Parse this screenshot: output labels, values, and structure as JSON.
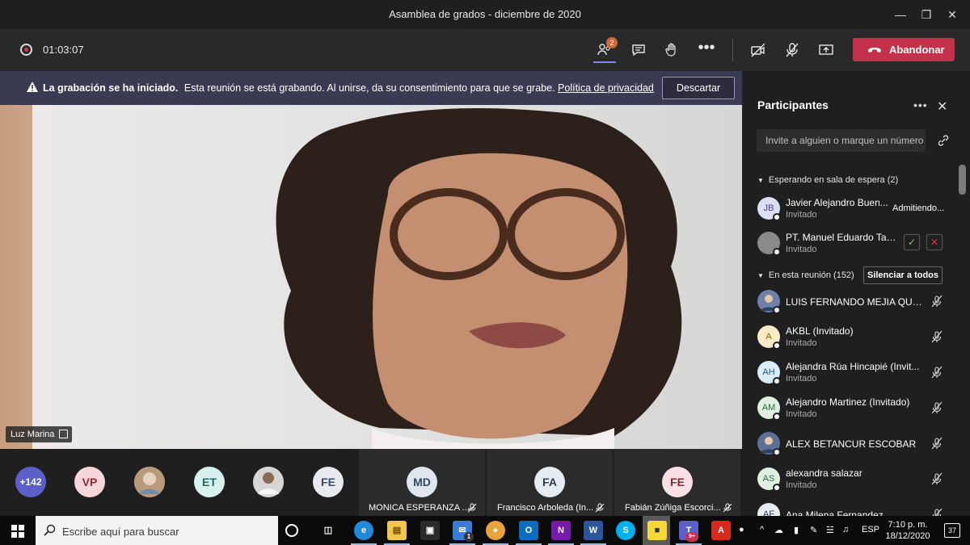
{
  "window": {
    "title": "Asamblea de grados - diciembre de 2020"
  },
  "toolbar": {
    "timer": "01:03:07",
    "participants_badge": "2",
    "leave_label": "Abandonar"
  },
  "banner": {
    "heading": "La grabación se ha iniciado.",
    "message": "Esta reunión se está grabando. Al unirse, da su consentimiento para que se grabe.",
    "link": "Política de privacidad",
    "dismiss_label": "Descartar"
  },
  "stage": {
    "speaker_name": "Luz Marina"
  },
  "strip": {
    "overflow_count": "+142",
    "avatars": [
      {
        "initials": "VP",
        "bg": "#f6d6d8",
        "fg": "#8b2b35"
      },
      {
        "initials": "",
        "bg": "#b99a7c",
        "fg": "#fff",
        "photo": true
      },
      {
        "initials": "ET",
        "bg": "#d8f0ee",
        "fg": "#1d6b66"
      },
      {
        "initials": "",
        "bg": "#c9c9c9",
        "fg": "#fff",
        "photo": true
      },
      {
        "initials": "FE",
        "bg": "#e8eaf0",
        "fg": "#3d4863"
      }
    ],
    "tiles": [
      {
        "initials": "MD",
        "name": "MONICA ESPERANZA ...",
        "bg": "#dfe6ee",
        "fg": "#2f4a66"
      },
      {
        "initials": "FA",
        "name": "Francisco Arboleda (In...",
        "bg": "#e6edf2",
        "fg": "#2d3d4b"
      },
      {
        "initials": "FE",
        "name": "Fabián Zúñiga Escorci...",
        "bg": "#fbe0e6",
        "fg": "#8a2336"
      }
    ]
  },
  "panel": {
    "title": "Participantes",
    "invite_placeholder": "Invite a alguien o marque un número",
    "lobby_label": "Esperando en sala de espera (2)",
    "in_meeting_label": "En esta reunión (152)",
    "mute_all_label": "Silenciar a todos",
    "admitting_label": "Admitiendo...",
    "lobby": [
      {
        "initials": "JB",
        "name": "Javier Alejandro Buen...",
        "sub": "Invitado",
        "bg": "#dcdff3",
        "fg": "#3b4199"
      },
      {
        "initials": "",
        "name": "PT. Manuel Eduardo Tab...",
        "sub": "Invitado",
        "bg": "#8a8a8a",
        "fg": "#fff"
      }
    ],
    "members": [
      {
        "initials": "",
        "name": "LUIS FERNANDO MEJIA QUIR...",
        "sub": "",
        "bg": "#6f7fa8",
        "fg": "#fff",
        "photo": true
      },
      {
        "initials": "A",
        "name": "AKBL (Invitado)",
        "sub": "Invitado",
        "bg": "#fbecc8",
        "fg": "#8a5a00"
      },
      {
        "initials": "AH",
        "name": "Alejandra Rúa Hincapié (Invit...",
        "sub": "Invitado",
        "bg": "#d9ecf7",
        "fg": "#1b5a80"
      },
      {
        "initials": "AM",
        "name": "Alejandro Martinez (Invitado)",
        "sub": "Invitado",
        "bg": "#dff0e2",
        "fg": "#2d6b37"
      },
      {
        "initials": "",
        "name": "ALEX BETANCUR ESCOBAR",
        "sub": "",
        "bg": "#5d6f94",
        "fg": "#fff",
        "photo": true
      },
      {
        "initials": "AS",
        "name": "alexandra salazar",
        "sub": "Invitado",
        "bg": "#dff0e2",
        "fg": "#2d6b37"
      },
      {
        "initials": "AF",
        "name": "Ana Milena Fernandez",
        "sub": "",
        "bg": "#e6edf2",
        "fg": "#2d3d4b"
      }
    ]
  },
  "taskbar": {
    "search_placeholder": "Escribe aquí para buscar",
    "mail_badge": "1",
    "teams_badge": "9+",
    "language": "ESP",
    "time": "7:10 p. m.",
    "date": "18/12/2020",
    "notifications": "37"
  },
  "colors": {
    "accent": "#7f85f5",
    "leave": "#c4314b",
    "banner": "#3b3a53"
  }
}
